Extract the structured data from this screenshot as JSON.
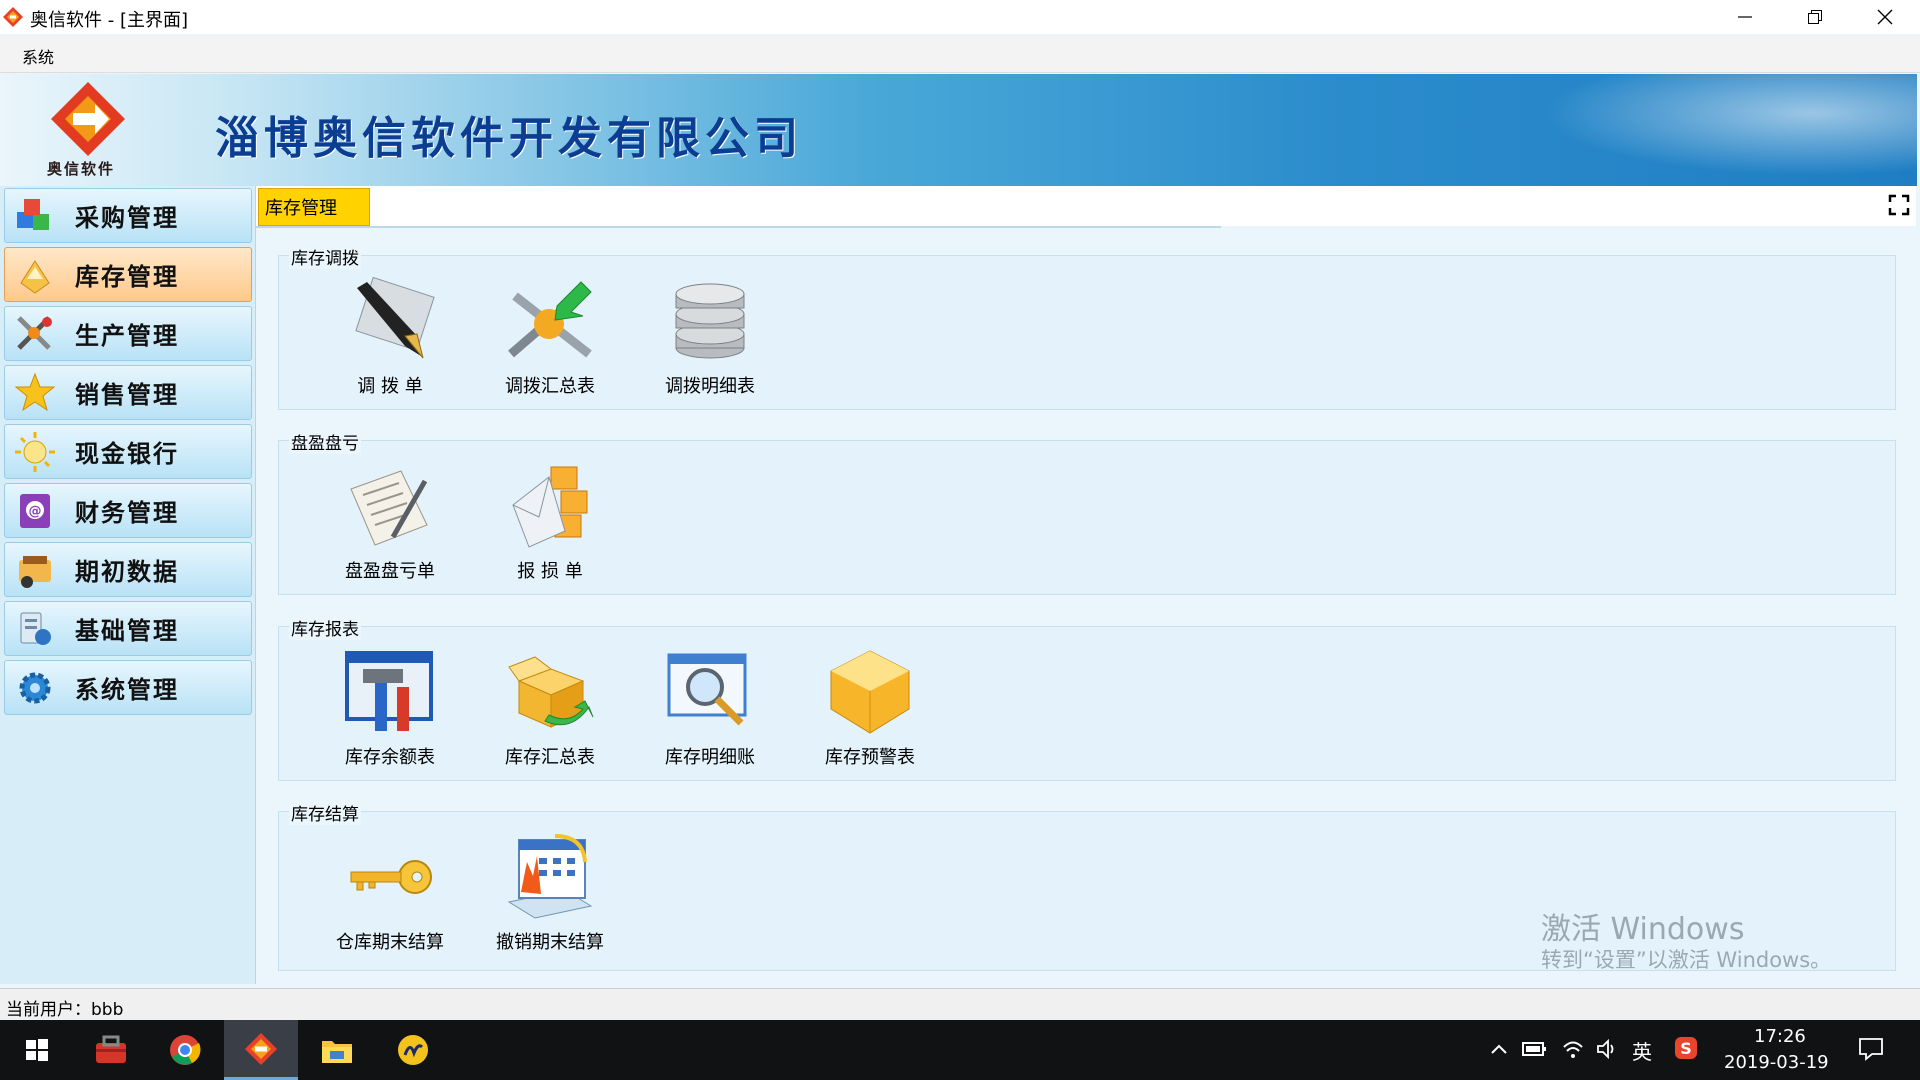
{
  "window": {
    "title": "奥信软件 - [主界面]"
  },
  "menu": {
    "items": [
      "系统"
    ]
  },
  "banner": {
    "logo_text": "奥信软件",
    "company": "淄博奥信软件开发有限公司"
  },
  "sidebar": {
    "items": [
      {
        "label": "采购管理",
        "icon": "purchase-cubes-icon"
      },
      {
        "label": "库存管理",
        "icon": "inventory-box-icon",
        "active": true
      },
      {
        "label": "生产管理",
        "icon": "production-tools-icon"
      },
      {
        "label": "销售管理",
        "icon": "sales-star-icon"
      },
      {
        "label": "现金银行",
        "icon": "cash-bank-icon"
      },
      {
        "label": "财务管理",
        "icon": "finance-book-icon"
      },
      {
        "label": "期初数据",
        "icon": "initial-data-icon"
      },
      {
        "label": "基础管理",
        "icon": "basic-management-icon"
      },
      {
        "label": "系统管理",
        "icon": "system-gear-icon"
      }
    ]
  },
  "tabs": [
    {
      "label": "库存管理",
      "active": true
    }
  ],
  "groups": [
    {
      "title": "库存调拨",
      "items": [
        {
          "label": "调 拨 单",
          "icon": "pen-icon"
        },
        {
          "label": "调拨汇总表",
          "icon": "transfer-arrow-icon"
        },
        {
          "label": "调拨明细表",
          "icon": "database-icon"
        }
      ]
    },
    {
      "title": "盘盈盘亏",
      "items": [
        {
          "label": "盘盈盘亏单",
          "icon": "document-pen-icon"
        },
        {
          "label": "报 损 单",
          "icon": "envelope-boxes-icon"
        }
      ]
    },
    {
      "title": "库存报表",
      "items": [
        {
          "label": "库存余额表",
          "icon": "tools-window-icon"
        },
        {
          "label": "库存汇总表",
          "icon": "open-box-icon"
        },
        {
          "label": "库存明细账",
          "icon": "magnifier-window-icon"
        },
        {
          "label": "库存预警表",
          "icon": "yellow-box-icon"
        }
      ]
    },
    {
      "title": "库存结算",
      "items": [
        {
          "label": "仓库期末结算",
          "icon": "key-icon"
        },
        {
          "label": "撤销期末结算",
          "icon": "calendar-icon"
        }
      ]
    }
  ],
  "watermark": {
    "line1": "激活 Windows",
    "line2": "转到“设置”以激活 Windows。"
  },
  "statusbar": {
    "text": "当前用户：bbb"
  },
  "taskbar": {
    "ime": "英",
    "time": "17:26",
    "date": "2019-03-19"
  }
}
